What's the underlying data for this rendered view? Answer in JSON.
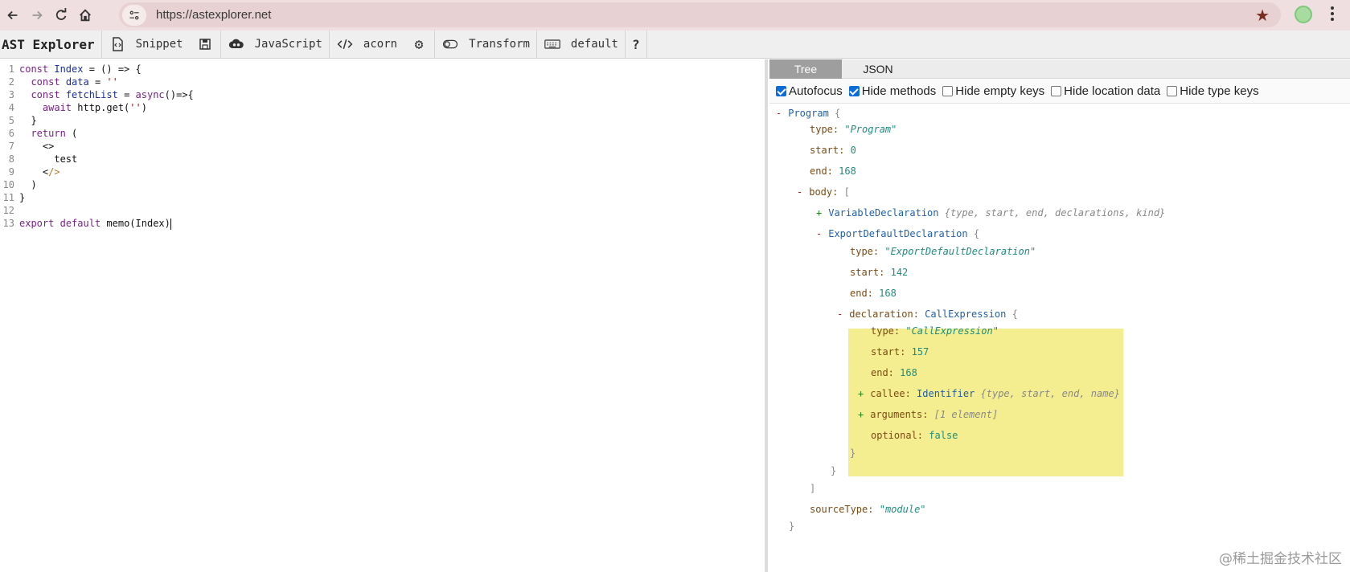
{
  "browser": {
    "url": "https://astexplorer.net"
  },
  "toolbar": {
    "brand": "AST Explorer",
    "snippet": "Snippet",
    "language": "JavaScript",
    "parser": "acorn",
    "transform": "Transform",
    "keymap": "default",
    "help": "?"
  },
  "editor": {
    "lines": [
      {
        "n": "1",
        "text": "const Index = () => {"
      },
      {
        "n": "2",
        "text": "  const data = ''"
      },
      {
        "n": "3",
        "text": "  const fetchList = async()=>{"
      },
      {
        "n": "4",
        "text": "    await http.get('')"
      },
      {
        "n": "5",
        "text": "  }"
      },
      {
        "n": "6",
        "text": "  return ("
      },
      {
        "n": "7",
        "text": "    <>"
      },
      {
        "n": "8",
        "text": "      test"
      },
      {
        "n": "9",
        "text": "    </>"
      },
      {
        "n": "10",
        "text": "  )"
      },
      {
        "n": "11",
        "text": "}"
      },
      {
        "n": "12",
        "text": ""
      },
      {
        "n": "13",
        "text": "export default memo(Index)"
      }
    ]
  },
  "panel": {
    "tabs": [
      "Tree",
      "JSON"
    ],
    "options": [
      {
        "label": "Autofocus",
        "checked": true
      },
      {
        "label": "Hide methods",
        "checked": true
      },
      {
        "label": "Hide empty keys",
        "checked": false
      },
      {
        "label": "Hide location data",
        "checked": false
      },
      {
        "label": "Hide type keys",
        "checked": false
      }
    ],
    "tree": {
      "program": "Program",
      "open_brace": "{",
      "close_brace": "}",
      "open_bracket": "[",
      "close_bracket": "]",
      "type_key": "type:",
      "start_key": "start:",
      "end_key": "end:",
      "body_key": "body:",
      "program_type": "\"Program\"",
      "program_start": "0",
      "program_end": "168",
      "var_decl": "VariableDeclaration",
      "var_decl_summary": "{type, start, end, declarations, kind}",
      "export_decl": "ExportDefaultDeclaration",
      "export_type": "\"ExportDefaultDeclaration\"",
      "export_start": "142",
      "export_end": "168",
      "declaration_key": "declaration:",
      "call_expr": "CallExpression",
      "call_type": "\"CallExpression\"",
      "call_start": "157",
      "call_end": "168",
      "callee_key": "callee:",
      "callee_node": "Identifier",
      "callee_summary": "{type, start, end, name}",
      "arguments_key": "arguments:",
      "arguments_summary": "[1 element]",
      "optional_key": "optional:",
      "optional_val": "false",
      "source_type_key": "sourceType:",
      "source_type_val": "\"module\""
    }
  },
  "watermark": "@稀土掘金技术社区",
  "colors": {
    "chrome": "#f0dfe0",
    "highlight": "#f4ee90",
    "minus": "#d0101a",
    "plus": "#1b8a1b"
  }
}
